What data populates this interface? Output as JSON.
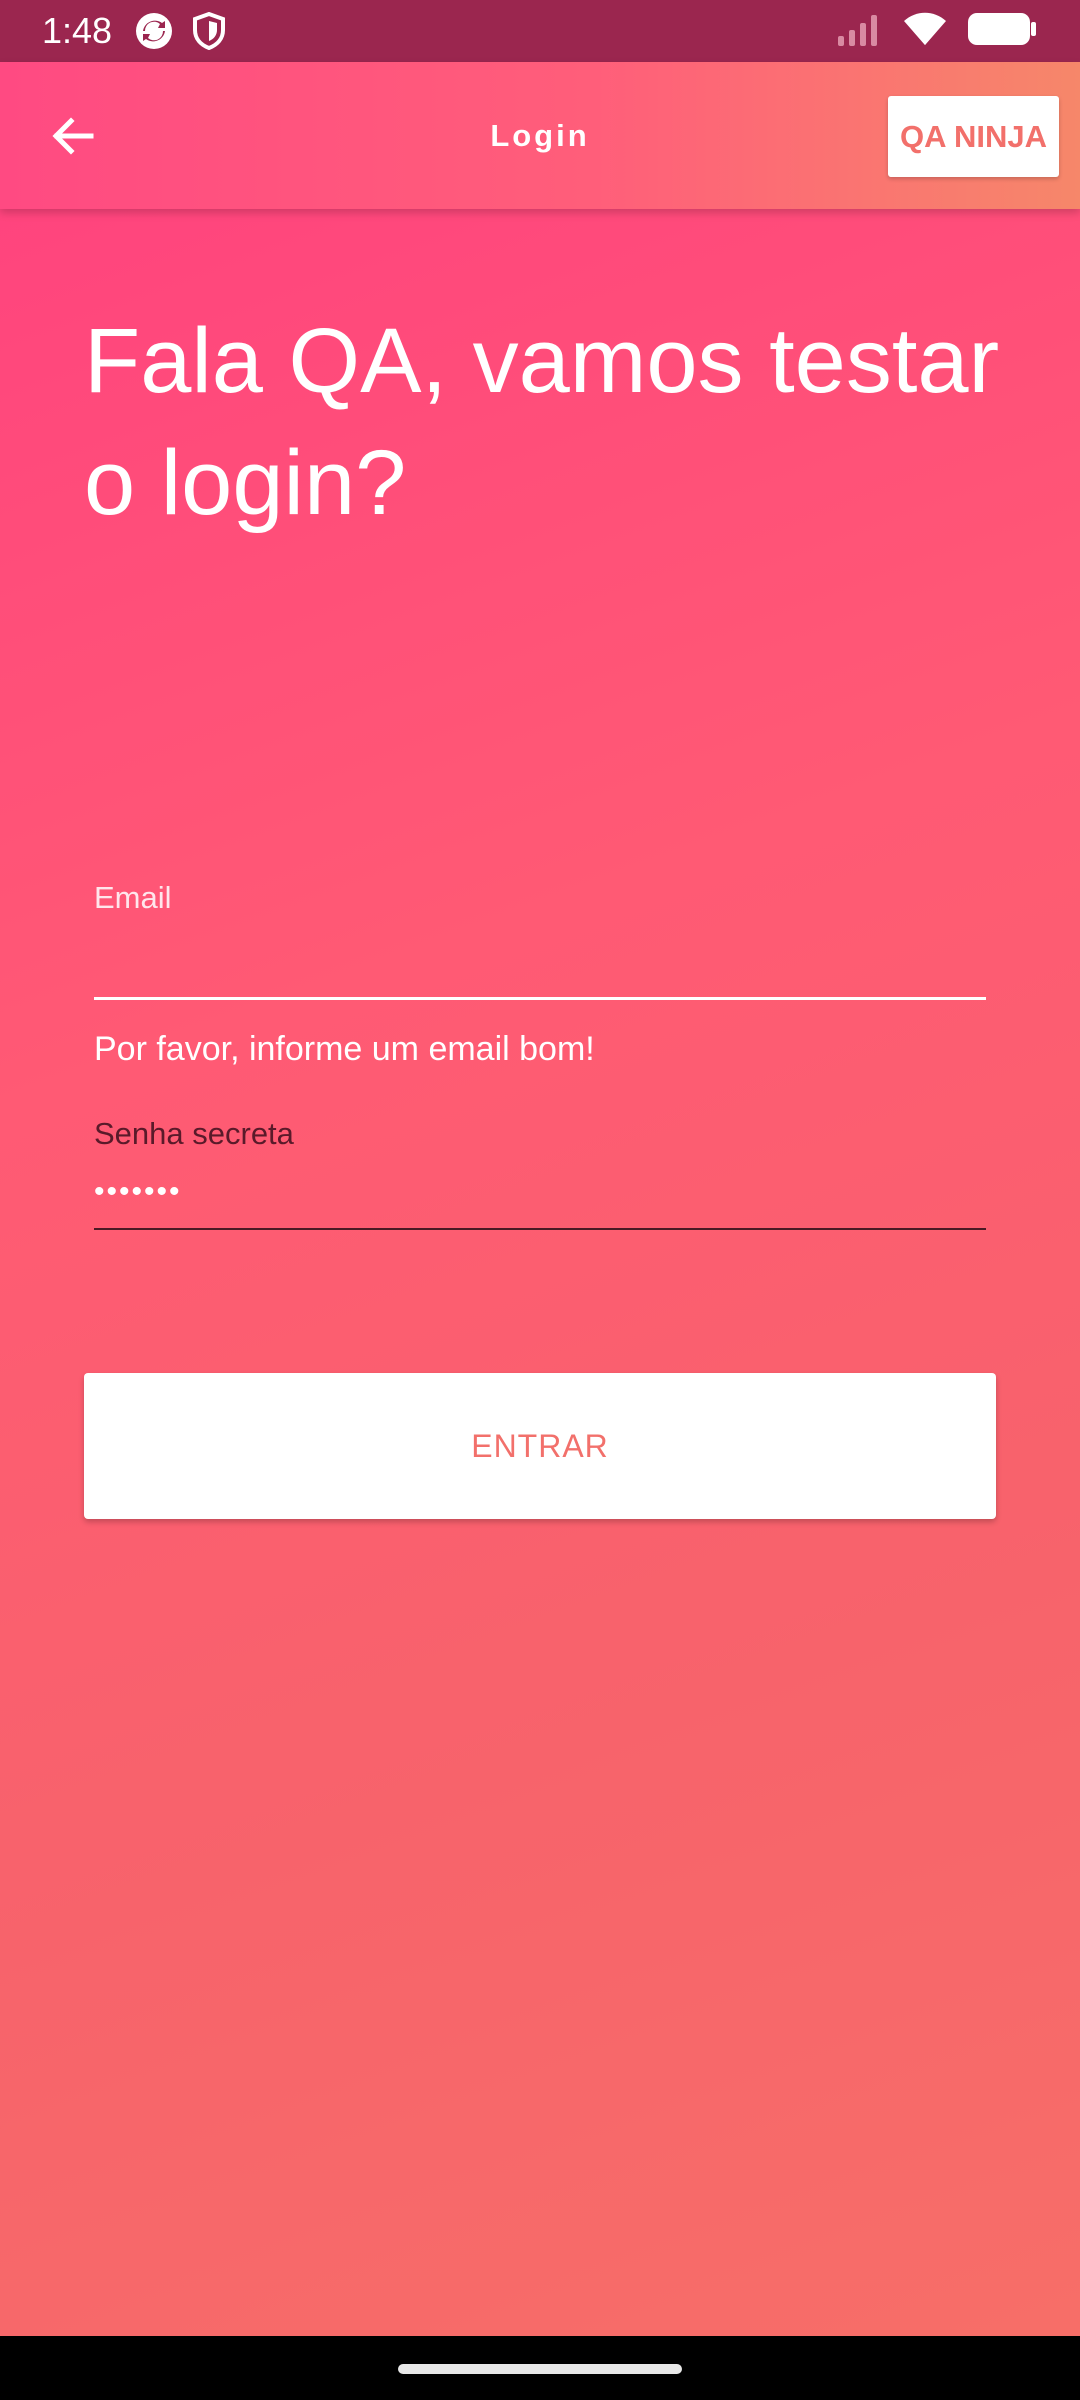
{
  "status_bar": {
    "time": "1:48",
    "icons": [
      "sync-icon",
      "shield-icon",
      "signal-icon",
      "wifi-icon",
      "battery-icon"
    ]
  },
  "app_bar": {
    "back_icon": "arrow-back-icon",
    "title": "Login",
    "action_label": "QA NINJA"
  },
  "main": {
    "headline": "Fala QA, vamos testar o login?",
    "email": {
      "label": "Email",
      "value": "",
      "error": "Por favor, informe um email bom!"
    },
    "password": {
      "label": "Senha secreta",
      "value_masked": "•••••••"
    },
    "login_button": "ENTRAR"
  },
  "colors": {
    "status_bar": "#9b264f",
    "accent_text": "#f2706b",
    "gradient_start": "#ff3f80",
    "gradient_end": "#f76f68"
  }
}
